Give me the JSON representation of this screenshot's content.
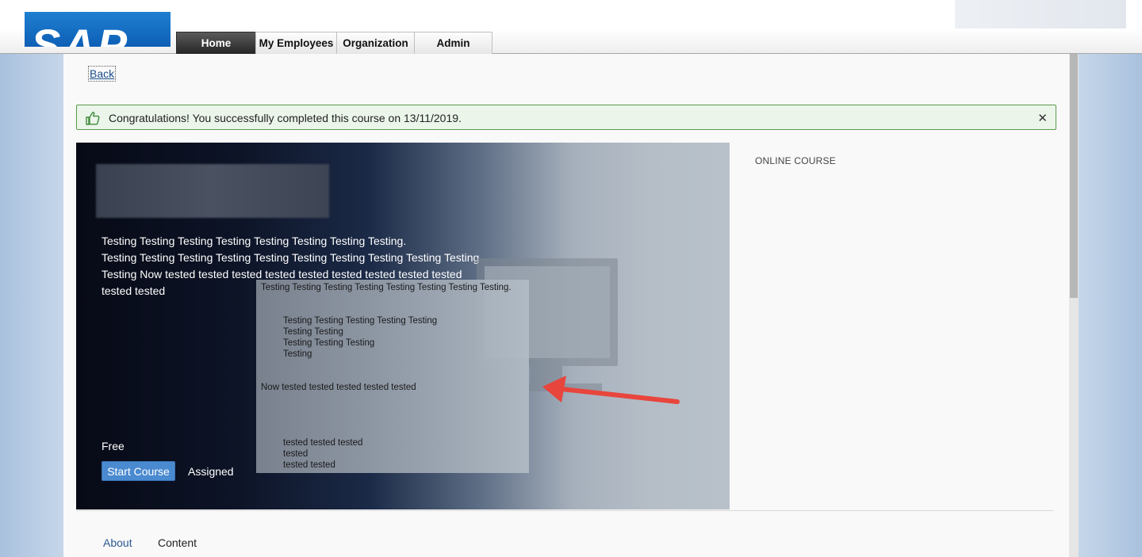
{
  "header": {
    "logo_text": "SAP",
    "nav": {
      "home": "Home",
      "my_employees": "My Employees",
      "organization": "Organization",
      "admin": "Admin"
    }
  },
  "page": {
    "back_label": "Back",
    "success_message": "Congratulations! You successfully completed this course on 13/11/2019.",
    "close_symbol": "✕"
  },
  "hero": {
    "description_lines": [
      "Testing Testing Testing Testing Testing Testing Testing Testing.",
      "Testing Testing Testing Testing Testing  Testing Testing  Testing Testing Testing",
      "Testing Now tested tested tested tested tested   tested tested tested  tested",
      "tested tested"
    ],
    "price_label": "Free",
    "start_button": "Start Course",
    "status_label": "Assigned"
  },
  "tooltip": {
    "first_line": "Testing Testing Testing Testing Testing Testing Testing Testing.",
    "list1": [
      "Testing Testing Testing Testing Testing",
      "Testing Testing",
      "Testing Testing Testing",
      "Testing"
    ],
    "now_line": "Now tested tested tested tested tested",
    "list2": [
      "tested tested tested",
      "tested",
      "tested tested"
    ]
  },
  "sidebar": {
    "course_type": "ONLINE COURSE"
  },
  "tabs": {
    "about": "About",
    "content": "Content"
  },
  "colors": {
    "accent_button": "#4a8ad0",
    "success_border": "#5a9a4a",
    "arrow": "#e8453c"
  }
}
